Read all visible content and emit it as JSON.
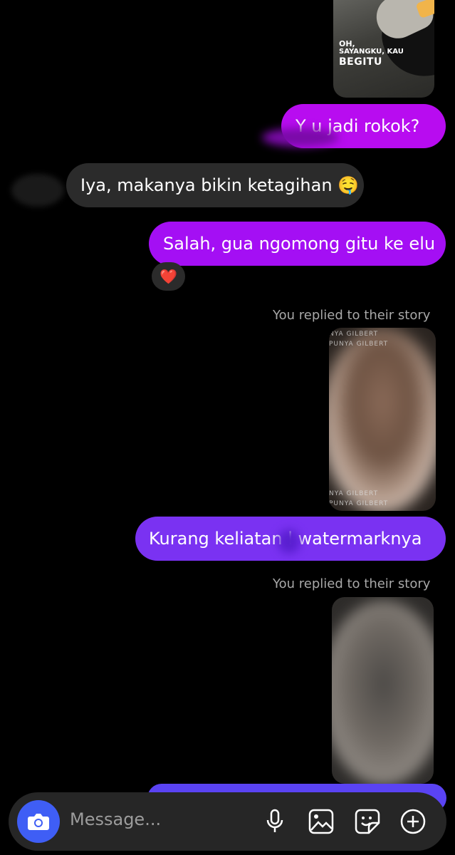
{
  "stories": [
    {
      "caption_line1": "OH,",
      "caption_line2": "SAYANGKU, KAU",
      "caption_line3": "BEGITU"
    },
    {
      "watermark_lines": [
        "NYA GILBERT",
        "PUNYA GILBERT",
        "NYA GILBERT",
        "PUNYA GILBERT"
      ]
    }
  ],
  "messages": [
    {
      "sender": "me",
      "text": "Y   u jadi rokok?"
    },
    {
      "sender": "them",
      "text": "Iya, makanya bikin ketagihan 🤤"
    },
    {
      "sender": "me",
      "text": "Salah, gua ngomong gitu ke elu",
      "reaction": "❤️"
    },
    {
      "sender": "me",
      "text": "Kurang keliatan    l watermarknya"
    }
  ],
  "story_reply_notes": [
    "You replied to their story",
    "You replied to their story"
  ],
  "composer": {
    "placeholder": "Message...",
    "icons": [
      "camera-icon",
      "microphone-icon",
      "gallery-icon",
      "sticker-icon",
      "add-icon"
    ]
  },
  "colors": {
    "background": "#000000",
    "bubble_magenta": "#b80cf0",
    "bubble_purple": "#a40ff4",
    "bubble_violet": "#7a32f2",
    "bubble_incoming": "#2b2b2b",
    "camera_button": "#3f5ef5"
  }
}
